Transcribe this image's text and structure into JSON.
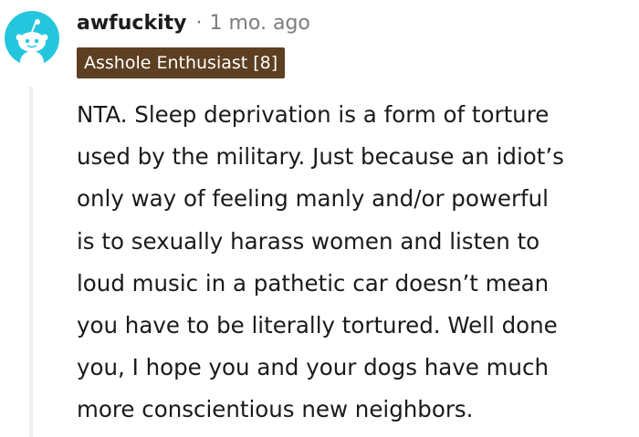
{
  "comment": {
    "username": "awfuckity",
    "separator": "·",
    "time_ago": "1 mo. ago",
    "flair": "Asshole Enthusiast [8]",
    "body_lines": [
      "NTA. Sleep deprivation is a form of torture",
      "used by the military. Just because an idiot’s",
      "only way of feeling manly and/or powerful",
      "is to sexually harass women and listen to",
      "loud music in a pathetic car doesn’t mean",
      "you have to be literally tortured. Well done",
      "you, I hope you and your dogs have much",
      "more conscientious new neighbors."
    ]
  },
  "icons": {
    "avatar": "reddit-snoo-avatar-icon"
  },
  "colors": {
    "avatar_bg": "#24c6de",
    "flair_bg": "#5d3f21",
    "flair_text": "#ffffff",
    "meta_text": "#7c7c7c",
    "thread_line": "#edeff1"
  }
}
